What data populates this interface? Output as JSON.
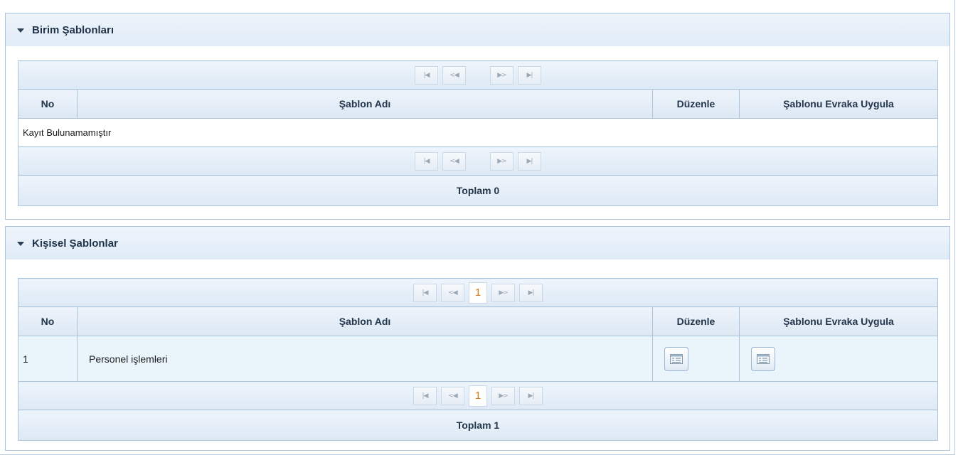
{
  "panels": [
    {
      "title": "Birim Şablonları",
      "columns": {
        "no": "No",
        "name": "Şablon Adı",
        "edit": "Düzenle",
        "apply": "Şablonu Evraka Uygula"
      },
      "empty_message": "Kayıt Bulunamamıştır",
      "total": "Toplam 0"
    },
    {
      "title": "Kişisel Şablonlar",
      "columns": {
        "no": "No",
        "name": "Şablon Adı",
        "edit": "Düzenle",
        "apply": "Şablonu Evraka Uygula"
      },
      "rows": [
        {
          "no": "1",
          "name": "Personel işlemleri",
          "edit_icon": "edit-form-icon",
          "apply_icon": "apply-form-icon"
        }
      ],
      "current_page": "1",
      "total": "Toplam 1"
    }
  ],
  "pager": {
    "first": "⏮",
    "prev": "<<",
    "next": ">>",
    "last": "⏭"
  },
  "colors": {
    "header_bg": "#e0ebf7",
    "border": "#aac4dc",
    "row_highlight": "#e9f4fb",
    "page_number": "#e07b12"
  }
}
